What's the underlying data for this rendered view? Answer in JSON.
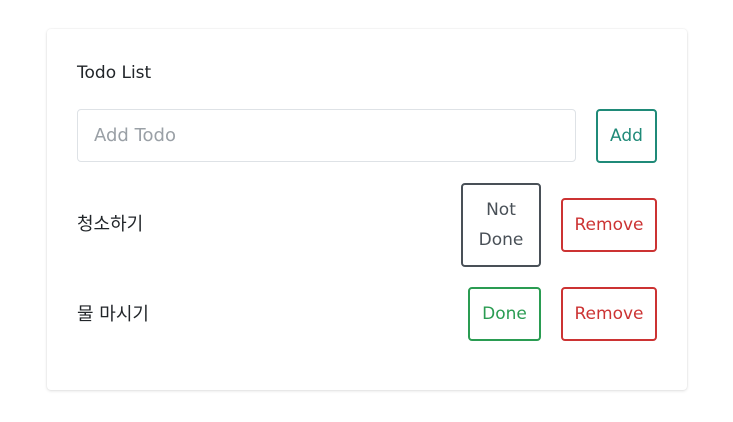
{
  "card": {
    "title": "Todo List",
    "input": {
      "placeholder": "Add Todo",
      "value": ""
    },
    "add_label": "Add"
  },
  "todos": [
    {
      "text": "청소하기",
      "toggle_label": "Not Done",
      "remove_label": "Remove"
    },
    {
      "text": "물 마시기",
      "toggle_label": "Done",
      "remove_label": "Remove"
    }
  ],
  "colors": {
    "add": "#1f8a78",
    "not_done": "#495057",
    "done": "#2a9c52",
    "remove": "#cc3333"
  }
}
